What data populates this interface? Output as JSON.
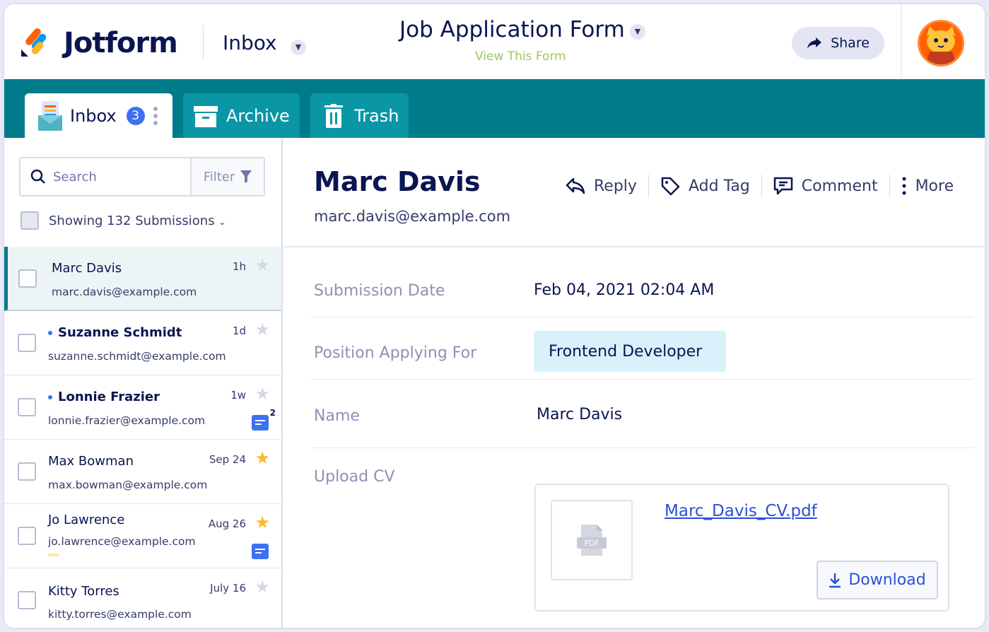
{
  "header": {
    "brand": "Jotform",
    "section": "Inbox",
    "form_title": "Job Application Form",
    "form_link": "View This Form",
    "share_label": "Share"
  },
  "tabs": [
    {
      "label": "Inbox",
      "badge": "3",
      "active": true
    },
    {
      "label": "Archive",
      "active": false
    },
    {
      "label": "Trash",
      "active": false
    }
  ],
  "sidebar": {
    "search_placeholder": "Search",
    "filter_label": "Filter",
    "showing_prefix": "Showing",
    "showing_count": "132",
    "showing_suffix": "Submissions",
    "submissions": [
      {
        "name": "Marc Davis",
        "email": "marc.davis@example.com",
        "time": "1h",
        "starred": false,
        "unread": false,
        "selected": true
      },
      {
        "name": "Suzanne Schmidt",
        "email": "suzanne.schmidt@example.com",
        "time": "1d",
        "starred": false,
        "unread": true
      },
      {
        "name": "Lonnie Frazier",
        "email": "lonnie.frazier@example.com",
        "time": "1w",
        "starred": false,
        "unread": true,
        "comments": "2"
      },
      {
        "name": "Max Bowman",
        "email": "max.bowman@example.com",
        "time": "Sep 24",
        "starred": true,
        "unread": false
      },
      {
        "name": "Jo Lawrence",
        "email": "jo.lawrence@example.com",
        "time": "Aug 26",
        "starred": true,
        "unread": false,
        "has_comment": true
      },
      {
        "name": "Kitty Torres",
        "email": "kitty.torres@example.com",
        "time": "July 16",
        "starred": false,
        "unread": false
      }
    ]
  },
  "detail": {
    "name": "Marc Davis",
    "email": "marc.davis@example.com",
    "actions": {
      "reply": "Reply",
      "add_tag": "Add Tag",
      "comment": "Comment",
      "more": "More"
    },
    "fields": [
      {
        "label": "Submission Date",
        "value": "Feb 04, 2021 02:04 AM"
      },
      {
        "label": "Position Applying For",
        "value": "Frontend Developer"
      },
      {
        "label": "Name",
        "value": "Marc Davis"
      },
      {
        "label": "Upload CV",
        "value": "Marc_Davis_CV.pdf"
      }
    ],
    "file": {
      "name": "Marc_Davis_CV.pdf",
      "thumb_label": "PDF",
      "download_label": "Download"
    }
  },
  "colors": {
    "teal": "#007b8a",
    "navy": "#0a1551",
    "accent_blue": "#3d71f0",
    "link_green": "#9ec85a",
    "star": "#ffb629"
  }
}
